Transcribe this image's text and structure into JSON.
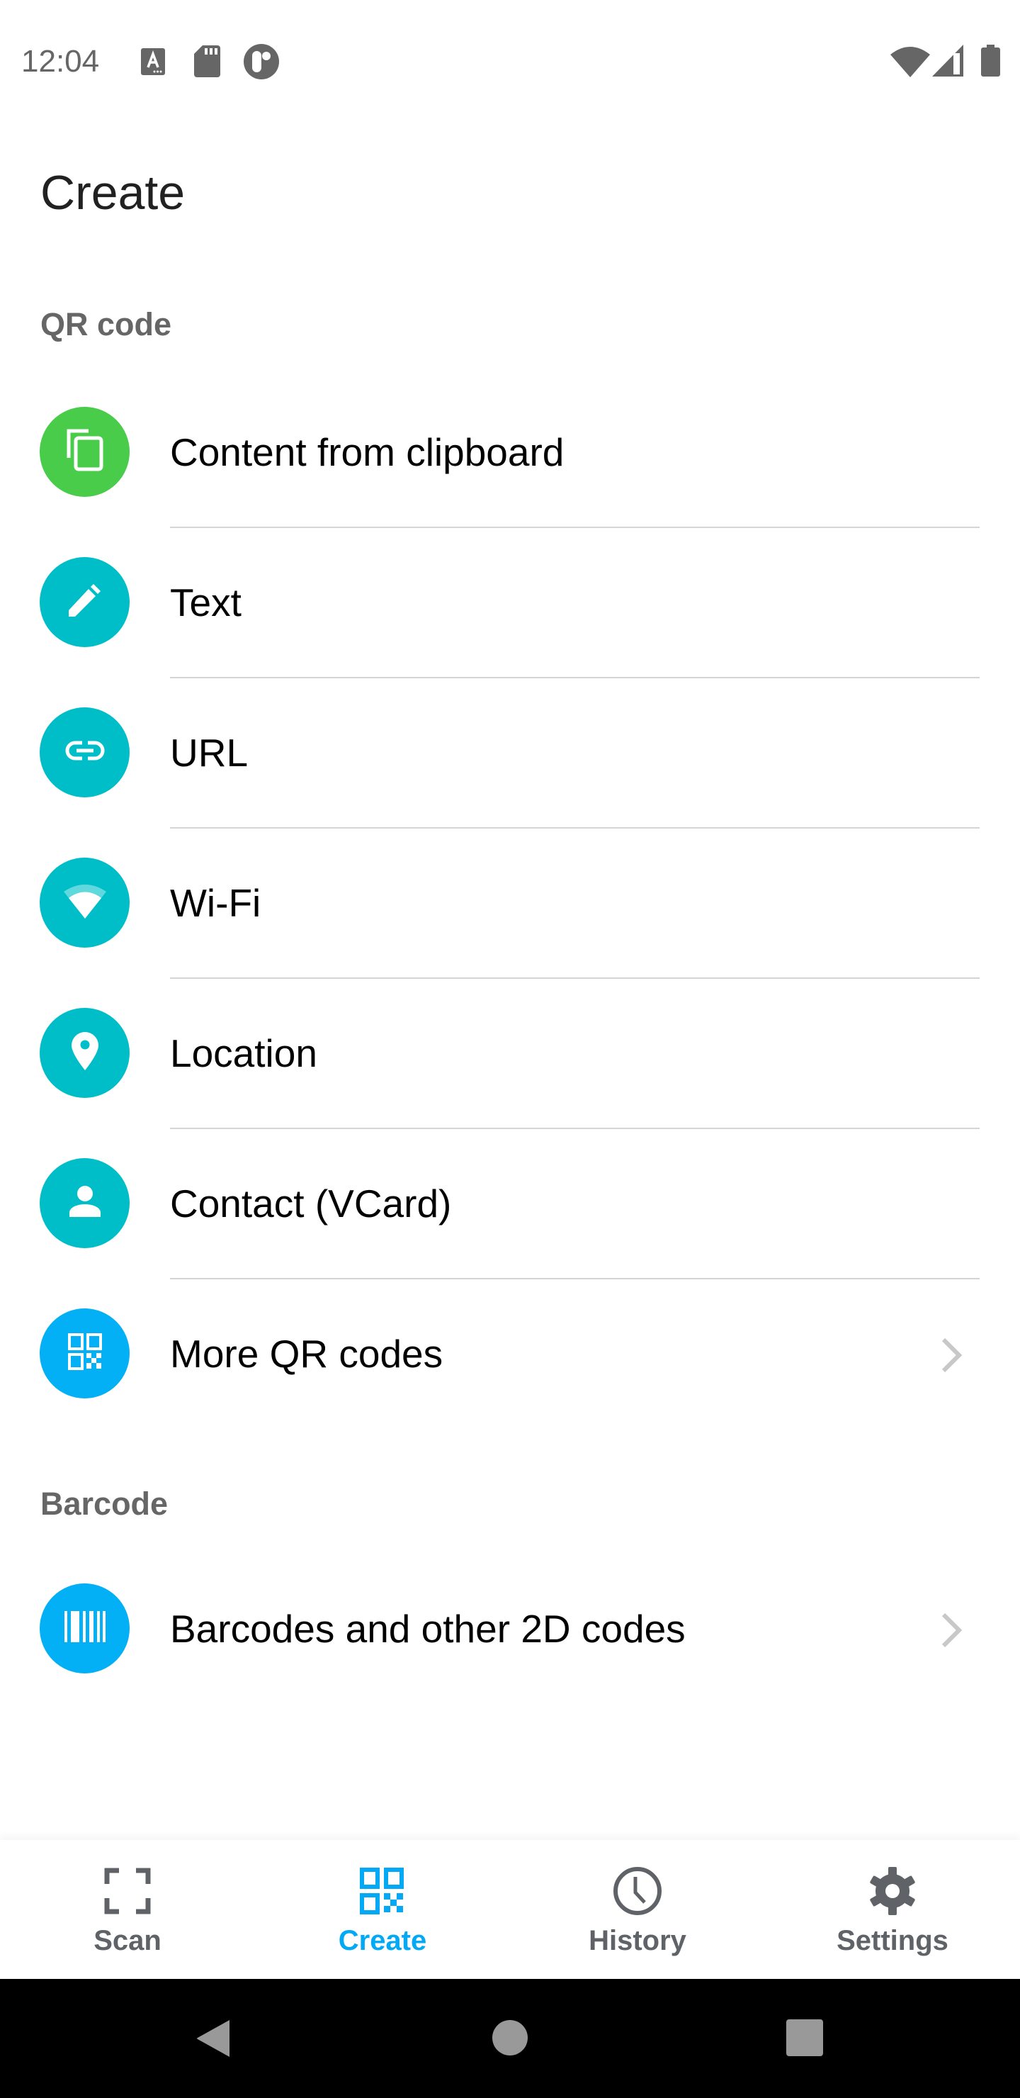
{
  "status_bar": {
    "time": "12:04",
    "left_icons": [
      "accessibility-a-icon",
      "sd-card-icon",
      "app-notification-icon"
    ],
    "right_icons": [
      "wifi-icon",
      "cell-signal-icon",
      "battery-icon"
    ]
  },
  "page": {
    "title": "Create"
  },
  "sections": [
    {
      "header": "QR code",
      "items": [
        {
          "label": "Content from clipboard",
          "icon": "clipboard-copy-icon",
          "color": "#48cc4a",
          "chevron": false
        },
        {
          "label": "Text",
          "icon": "pencil-icon",
          "color": "#00bec8",
          "chevron": false
        },
        {
          "label": "URL",
          "icon": "link-icon",
          "color": "#00bec8",
          "chevron": false
        },
        {
          "label": "Wi-Fi",
          "icon": "wifi-icon",
          "color": "#00bec8",
          "chevron": false
        },
        {
          "label": "Location",
          "icon": "location-pin-icon",
          "color": "#00bec8",
          "chevron": false
        },
        {
          "label": "Contact (VCard)",
          "icon": "person-icon",
          "color": "#00bec8",
          "chevron": false
        },
        {
          "label": "More QR codes",
          "icon": "qr-code-icon",
          "color": "#03b0f5",
          "chevron": true
        }
      ]
    },
    {
      "header": "Barcode",
      "items": [
        {
          "label": "Barcodes and other 2D codes",
          "icon": "barcode-icon",
          "color": "#03b0f5",
          "chevron": true
        }
      ]
    }
  ],
  "bottom_nav": {
    "active": "Create",
    "accent_color": "#03a9f4",
    "inactive_color": "#5f6368",
    "tabs": [
      {
        "label": "Scan",
        "icon": "scan-frame-icon"
      },
      {
        "label": "Create",
        "icon": "qr-code-icon"
      },
      {
        "label": "History",
        "icon": "clock-icon"
      },
      {
        "label": "Settings",
        "icon": "gear-icon"
      }
    ]
  },
  "system_nav": {
    "buttons": [
      "back",
      "home",
      "recents"
    ]
  }
}
